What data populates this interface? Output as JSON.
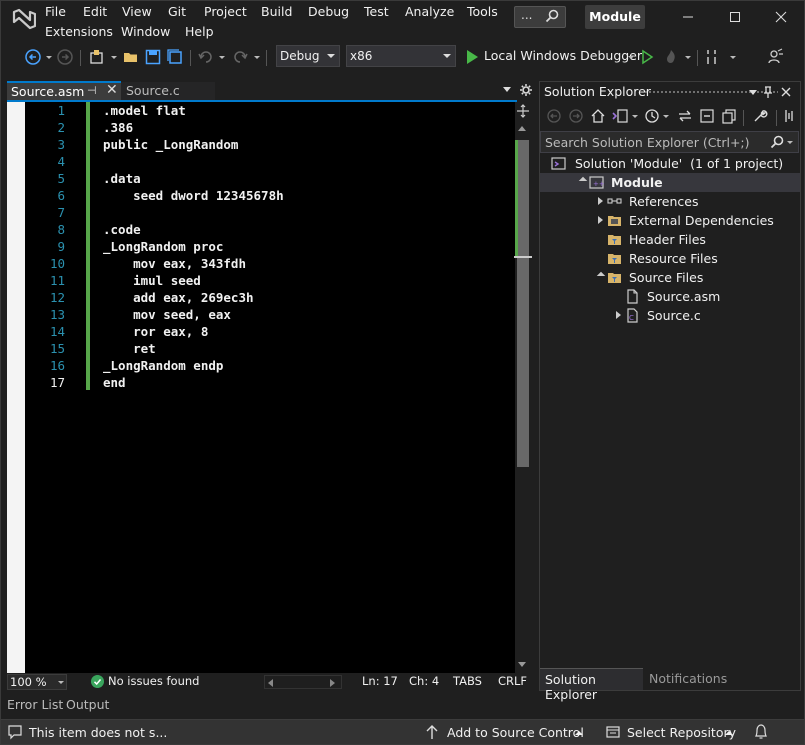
{
  "menu": {
    "items": [
      "File",
      "Edit",
      "View",
      "Git",
      "Project",
      "Build",
      "Debug",
      "Test",
      "Analyze",
      "Tools",
      "Extensions",
      "Window",
      "Help"
    ],
    "search_dots": "...",
    "solution_title": "Module"
  },
  "toolbar": {
    "config": "Debug",
    "platform": "x86",
    "debugger": "Local Windows Debugger"
  },
  "editor": {
    "tabs": [
      {
        "label": "Source.asm",
        "active": true,
        "pin": "⊣",
        "close": "✕"
      },
      {
        "label": "Source.c",
        "active": false
      }
    ],
    "current_line": 17,
    "lines": [
      {
        "n": "1",
        "text": ".model flat"
      },
      {
        "n": "2",
        "text": ".386"
      },
      {
        "n": "3",
        "text": "public _LongRandom"
      },
      {
        "n": "4",
        "text": ""
      },
      {
        "n": "5",
        "text": ".data"
      },
      {
        "n": "6",
        "text": "    seed dword 12345678h"
      },
      {
        "n": "7",
        "text": ""
      },
      {
        "n": "8",
        "text": ".code"
      },
      {
        "n": "9",
        "text": "_LongRandom proc"
      },
      {
        "n": "10",
        "text": "    mov eax, 343fdh"
      },
      {
        "n": "11",
        "text": "    imul seed"
      },
      {
        "n": "12",
        "text": "    add eax, 269ec3h"
      },
      {
        "n": "13",
        "text": "    mov seed, eax"
      },
      {
        "n": "14",
        "text": "    ror eax, 8"
      },
      {
        "n": "15",
        "text": "    ret"
      },
      {
        "n": "16",
        "text": "_LongRandom endp"
      },
      {
        "n": "17",
        "text": "end"
      }
    ],
    "status": {
      "zoom": "100 %",
      "issues": "No issues found",
      "ln": "Ln: 17",
      "ch": "Ch: 4",
      "tabs": "TABS",
      "eol": "CRLF"
    }
  },
  "solution_explorer": {
    "title": "Solution Explorer",
    "search_placeholder": "Search Solution Explorer (Ctrl+;)",
    "tree": [
      {
        "label": "Solution 'Module'  (1 of 1 project)",
        "indent": 0,
        "expander": "none",
        "icon": "solution-icon"
      },
      {
        "label": "Module",
        "indent": 1,
        "expander": "down",
        "icon": "cpp-project-icon",
        "selected": true,
        "bold": true
      },
      {
        "label": "References",
        "indent": 2,
        "expander": "right",
        "icon": "references-icon"
      },
      {
        "label": "External Dependencies",
        "indent": 2,
        "expander": "right",
        "icon": "external-dependencies-icon"
      },
      {
        "label": "Header Files",
        "indent": 2,
        "expander": "none",
        "icon": "filter-folder-icon"
      },
      {
        "label": "Resource Files",
        "indent": 2,
        "expander": "none",
        "icon": "filter-folder-icon"
      },
      {
        "label": "Source Files",
        "indent": 2,
        "expander": "down",
        "icon": "filter-folder-icon"
      },
      {
        "label": "Source.asm",
        "indent": 3,
        "expander": "none",
        "icon": "file-icon"
      },
      {
        "label": "Source.c",
        "indent": 3,
        "expander": "right",
        "icon": "c-file-icon"
      }
    ],
    "bottom_tabs": [
      "Solution Explorer",
      "Notifications"
    ]
  },
  "bottom_tabs": [
    "Error List",
    "Output"
  ],
  "statusbar": {
    "message": "This item does not s...",
    "source_control": "Add to Source Control",
    "repository": "Select Repository"
  },
  "colors": {
    "accent": "#007acc",
    "change_bar": "#57a64a",
    "line_number": "#2b91af",
    "vs_purple": "#9a72d8"
  }
}
